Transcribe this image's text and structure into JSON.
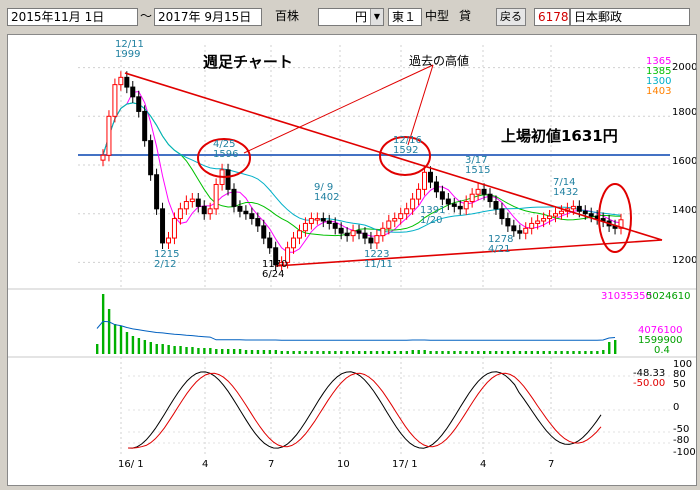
{
  "toolbar": {
    "date_start": "2015年11月 1日",
    "tilde": "～",
    "date_end": "2017年 9月15日",
    "unit_label": "百株",
    "currency": "円",
    "market": "東１",
    "size_class": "中型",
    "lending": "貸",
    "back_button": "戻る",
    "code": "6178",
    "company": "日本郵政"
  },
  "price_panel": {
    "title": "週足チャート",
    "past_high_label": "過去の高値",
    "ipo_label": "上場初値1631円",
    "ma_values": [
      "1365",
      "1385",
      "1300",
      "1403"
    ],
    "y_ticks": [
      "2000",
      "1800",
      "1600",
      "1400",
      "1200"
    ],
    "annotations": [
      {
        "date": "12/11",
        "price": "1999"
      },
      {
        "date": "4/25",
        "price": "1596"
      },
      {
        "date": "12/16",
        "price": "1592"
      },
      {
        "date": "3/17",
        "price": "1515"
      },
      {
        "date": "9/ 9",
        "price": "1402"
      },
      {
        "date": "7/14",
        "price": "1432"
      },
      {
        "price": "1215",
        "date": "2/12"
      },
      {
        "price": "1170",
        "date": "6/24"
      },
      {
        "price": "1223",
        "date": "11/11"
      },
      {
        "price": "1391",
        "date": "1/20"
      },
      {
        "price": "1278",
        "date": "4/21"
      }
    ]
  },
  "volume_panel": {
    "label_left": "31035350",
    "label_right": "5024610",
    "values": [
      "4076100",
      "1599900",
      "0.4"
    ]
  },
  "osc_panel": {
    "values": [
      "-48.33",
      "-50.00"
    ],
    "y_ticks": [
      "100",
      "80",
      "50",
      "0",
      "-50",
      "-80",
      "-100"
    ]
  },
  "x_axis": [
    "16/ 1",
    "4",
    "7",
    "10",
    "17/ 1",
    "4",
    "7"
  ],
  "colors": {
    "candle_up": "#ff0000",
    "candle_down": "#000000",
    "ma_short": "#ff00ff",
    "ma_mid": "#00c000",
    "ma_long": "#00b0c8",
    "ma_extra": "#ff8000",
    "ipo_line": "#4472c4",
    "trend_line": "#e00000"
  }
}
